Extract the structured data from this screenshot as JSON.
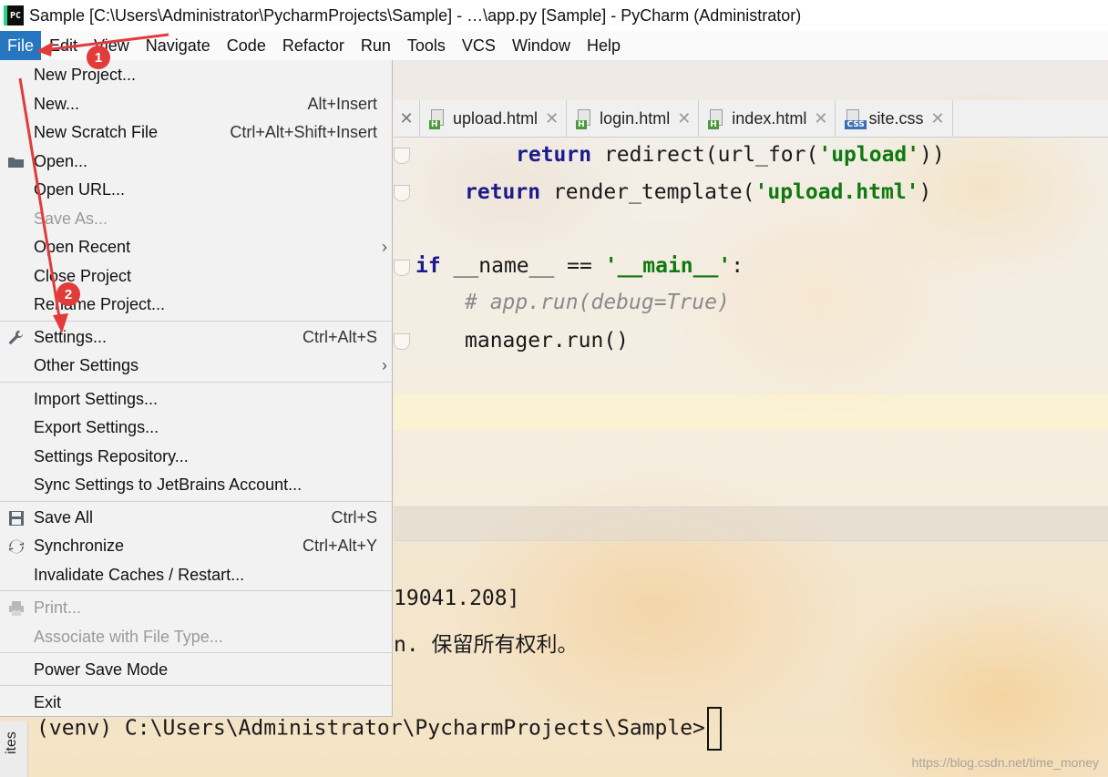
{
  "window": {
    "title": "Sample [C:\\Users\\Administrator\\PycharmProjects\\Sample] - …\\app.py [Sample] - PyCharm (Administrator)",
    "app_icon_text": "PC"
  },
  "menubar": {
    "file": "File",
    "edit": "Edit",
    "view": "View",
    "navigate": "Navigate",
    "code": "Code",
    "refactor": "Refactor",
    "run": "Run",
    "tools": "Tools",
    "vcs": "VCS",
    "window": "Window",
    "help": "Help"
  },
  "file_menu": {
    "new_project": "New Project...",
    "new": "New...",
    "new_shortcut": "Alt+Insert",
    "new_scratch": "New Scratch File",
    "new_scratch_shortcut": "Ctrl+Alt+Shift+Insert",
    "open": "Open...",
    "open_url": "Open URL...",
    "save_as": "Save As...",
    "open_recent": "Open Recent",
    "close_project": "Close Project",
    "rename_project": "Rename Project...",
    "settings": "Settings...",
    "settings_shortcut": "Ctrl+Alt+S",
    "other_settings": "Other Settings",
    "import_settings": "Import Settings...",
    "export_settings": "Export Settings...",
    "settings_repository": "Settings Repository...",
    "sync_settings": "Sync Settings to JetBrains Account...",
    "save_all": "Save All",
    "save_all_shortcut": "Ctrl+S",
    "synchronize": "Synchronize",
    "synchronize_shortcut": "Ctrl+Alt+Y",
    "invalidate_caches": "Invalidate Caches / Restart...",
    "print": "Print...",
    "associate_file_type": "Associate with File Type...",
    "power_save_mode": "Power Save Mode",
    "exit": "Exit"
  },
  "editor_tabs": [
    {
      "name": "upload.html",
      "type": "H"
    },
    {
      "name": "login.html",
      "type": "H"
    },
    {
      "name": "index.html",
      "type": "H"
    },
    {
      "name": "site.css",
      "type": "CSS"
    }
  ],
  "code": {
    "line1_kw": "return",
    "line1_fn": " redirect(url_for(",
    "line1_str": "'upload'",
    "line1_end": "))",
    "line2_kw": "return",
    "line2_fn": " render_template(",
    "line2_str": "'upload.html'",
    "line2_end": ")",
    "line3_kw": "if",
    "line3_mid": " __name__ == ",
    "line3_str": "'__main__'",
    "line3_end": ":",
    "line4_comment": "# app.run(debug=True)",
    "line5": "manager.run()"
  },
  "terminal": {
    "line1": "19041.208]",
    "line2": "n. 保留所有权利。",
    "prompt": "(venv) C:\\Users\\Administrator\\PycharmProjects\\Sample>"
  },
  "side_tool": {
    "label": "ites"
  },
  "watermark": "https://blog.csdn.net/time_money",
  "annotations": {
    "badge1": "1",
    "badge2": "2",
    "color": "#e13b3b"
  },
  "colors": {
    "menu_active": "#2675bf",
    "keyword": "#1b1b8f",
    "string": "#0e7a0e"
  }
}
